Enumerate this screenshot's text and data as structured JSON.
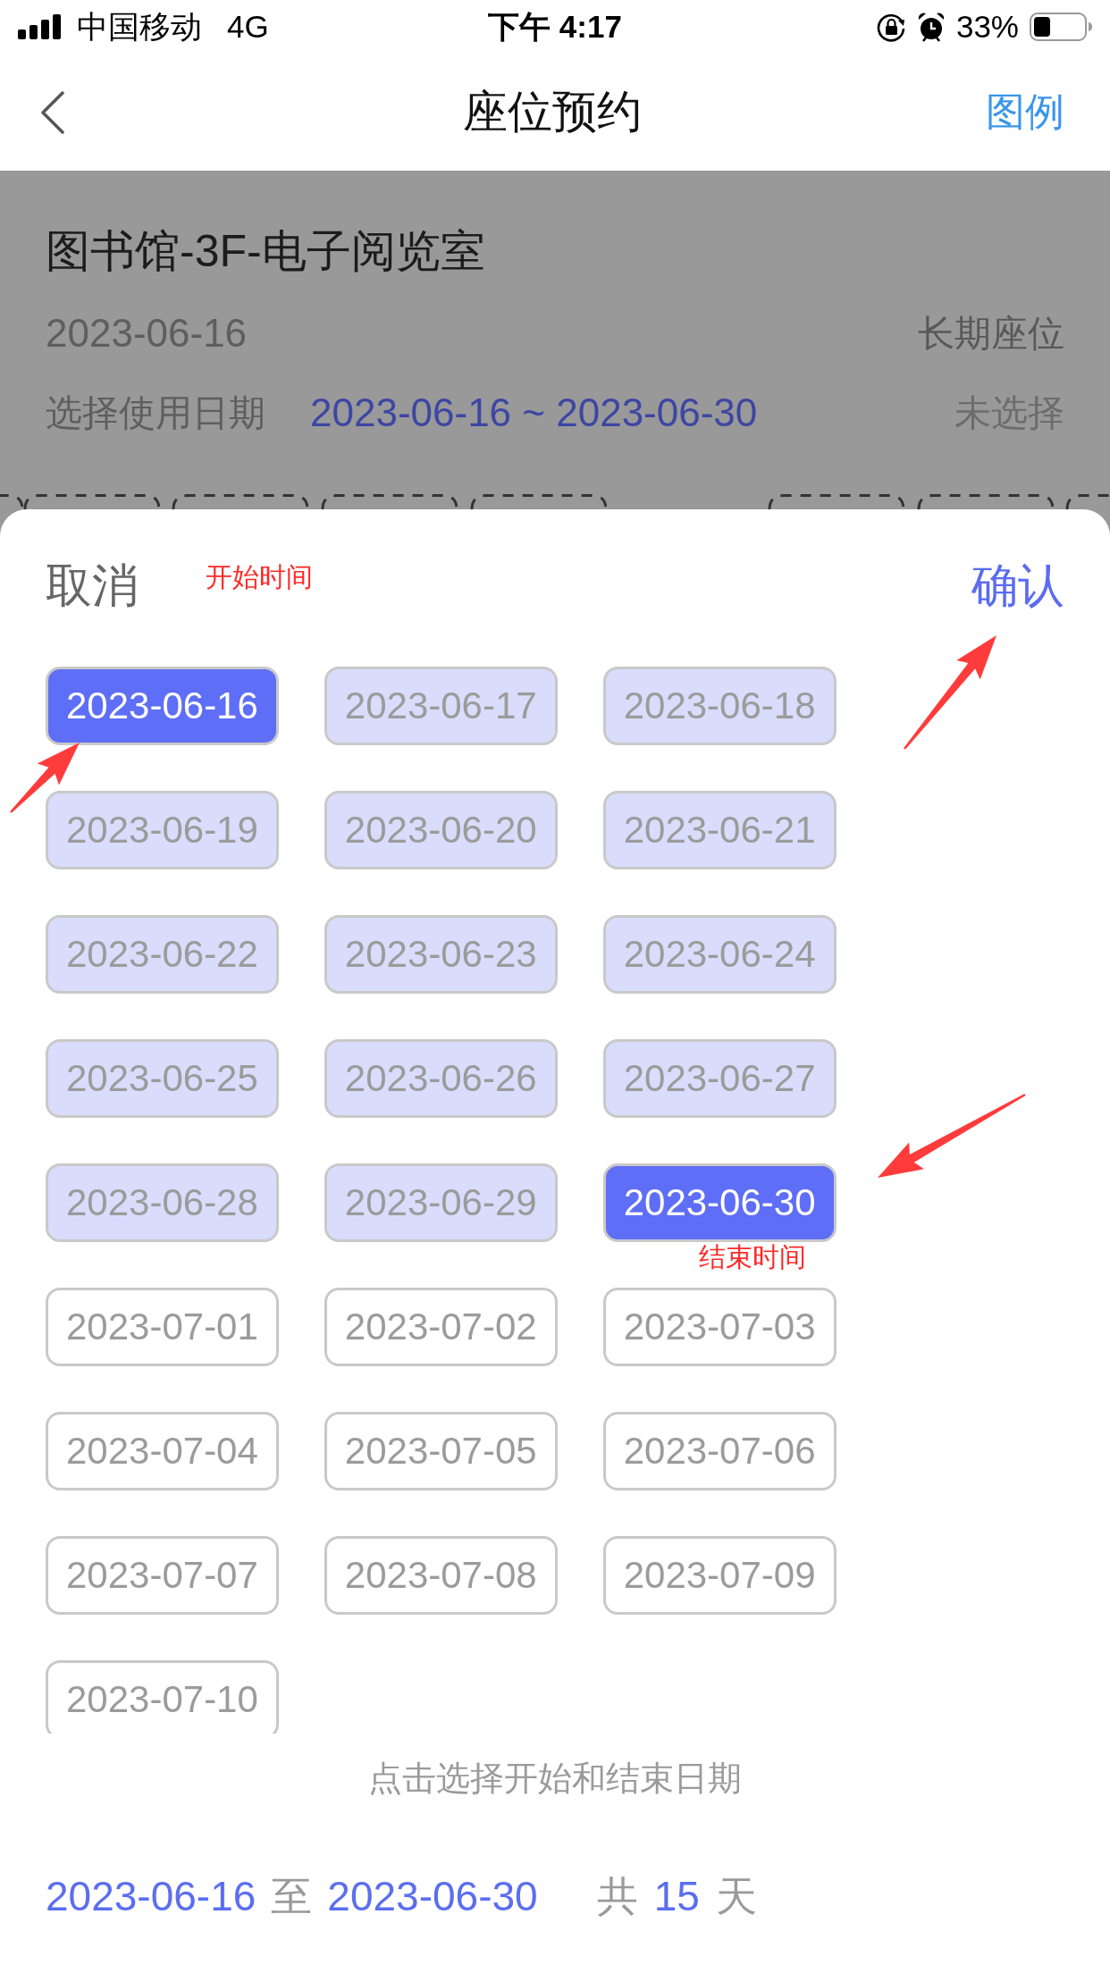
{
  "status_bar": {
    "carrier": "中国移动",
    "network": "4G",
    "time": "下午 4:17",
    "battery": "33%"
  },
  "nav_bar": {
    "title": "座位预约",
    "action": "图例"
  },
  "room": {
    "name": "图书馆-3F-电子阅览室",
    "date": "2023-06-16",
    "seat_type": "长期座位",
    "date_label": "选择使用日期",
    "date_range": "2023-06-16 ~ 2023-06-30",
    "seat_status": "未选择"
  },
  "date_sheet": {
    "cancel": "取消",
    "start_note": "开始时间",
    "confirm": "确认",
    "dates": [
      {
        "label": "2023-06-16",
        "selected": true,
        "in_range": true
      },
      {
        "label": "2023-06-17",
        "selected": false,
        "in_range": true
      },
      {
        "label": "2023-06-18",
        "selected": false,
        "in_range": true
      },
      {
        "label": "2023-06-19",
        "selected": false,
        "in_range": true
      },
      {
        "label": "2023-06-20",
        "selected": false,
        "in_range": true
      },
      {
        "label": "2023-06-21",
        "selected": false,
        "in_range": true
      },
      {
        "label": "2023-06-22",
        "selected": false,
        "in_range": true
      },
      {
        "label": "2023-06-23",
        "selected": false,
        "in_range": true
      },
      {
        "label": "2023-06-24",
        "selected": false,
        "in_range": true
      },
      {
        "label": "2023-06-25",
        "selected": false,
        "in_range": true
      },
      {
        "label": "2023-06-26",
        "selected": false,
        "in_range": true
      },
      {
        "label": "2023-06-27",
        "selected": false,
        "in_range": true
      },
      {
        "label": "2023-06-28",
        "selected": false,
        "in_range": true
      },
      {
        "label": "2023-06-29",
        "selected": false,
        "in_range": true
      },
      {
        "label": "2023-06-30",
        "selected": true,
        "in_range": true,
        "note": "结束时间"
      },
      {
        "label": "2023-07-01",
        "selected": false,
        "in_range": false
      },
      {
        "label": "2023-07-02",
        "selected": false,
        "in_range": false
      },
      {
        "label": "2023-07-03",
        "selected": false,
        "in_range": false
      },
      {
        "label": "2023-07-04",
        "selected": false,
        "in_range": false
      },
      {
        "label": "2023-07-05",
        "selected": false,
        "in_range": false
      },
      {
        "label": "2023-07-06",
        "selected": false,
        "in_range": false
      },
      {
        "label": "2023-07-07",
        "selected": false,
        "in_range": false
      },
      {
        "label": "2023-07-08",
        "selected": false,
        "in_range": false
      },
      {
        "label": "2023-07-09",
        "selected": false,
        "in_range": false
      },
      {
        "label": "2023-07-10",
        "selected": false,
        "in_range": false
      }
    ],
    "hint": "点击选择开始和结束日期",
    "summary": {
      "start": "2023-06-16",
      "to": "至",
      "end": "2023-06-30",
      "total_prefix": "共",
      "days": "15",
      "total_suffix": "天"
    }
  }
}
